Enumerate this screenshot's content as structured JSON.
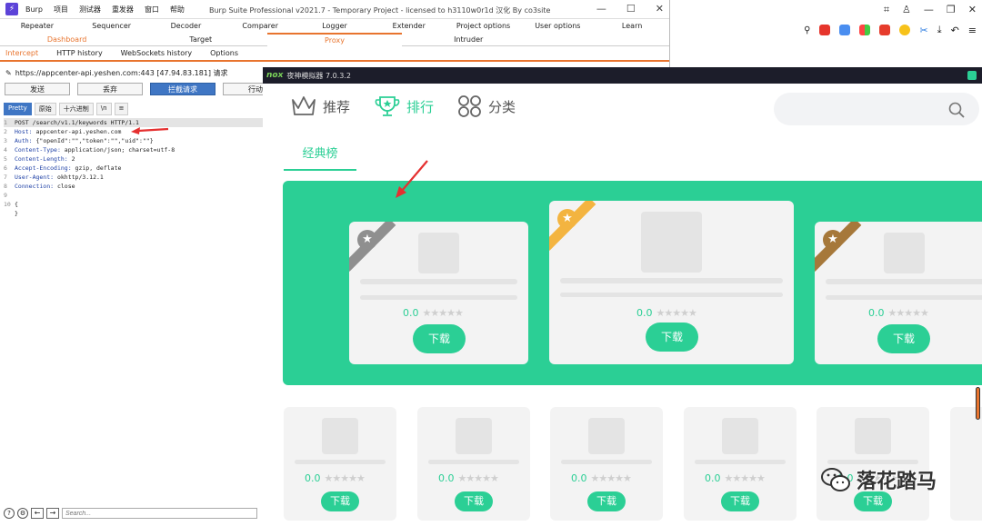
{
  "burp": {
    "window_title": "Burp Suite Professional v2021.7 - Temporary Project - licensed to h3110w0r1d 汉化 By co3site",
    "menu": [
      "Burp",
      "项目",
      "测试器",
      "重发器",
      "窗口",
      "帮助"
    ],
    "tabs_row1": [
      "Repeater",
      "Sequencer",
      "Decoder",
      "Comparer",
      "Logger",
      "Extender",
      "Project options",
      "User options",
      "Learn"
    ],
    "tabs_row2": [
      "Dashboard",
      "Target",
      "Proxy",
      "Intruder",
      ""
    ],
    "proxy_tabs": [
      "Intercept",
      "HTTP history",
      "WebSockets history",
      "Options"
    ],
    "request_info": "https://appcenter-api.yeshen.com:443  [47.94.83.181] 请求",
    "buttons": {
      "forward": "发送",
      "drop": "丢弃",
      "intercept": "拦截请求",
      "action": "行动"
    },
    "editor_tabs": [
      "Pretty",
      "原始",
      "十六进制",
      "\\n",
      "≡"
    ],
    "request_lines": [
      {
        "n": "1",
        "text": "POST /search/v1.1/keywords HTTP/1.1"
      },
      {
        "n": "2",
        "key": "Host:",
        "text": " appcenter-api.yeshen.com"
      },
      {
        "n": "3",
        "key": "Auth:",
        "text": " {\"openId\":\"\",\"token\":\"\",\"uid\":\"\"}"
      },
      {
        "n": "4",
        "key": "Content-Type:",
        "text": " application/json; charset=utf-8"
      },
      {
        "n": "5",
        "key": "Content-Length:",
        "text": " 2"
      },
      {
        "n": "6",
        "key": "Accept-Encoding:",
        "text": " gzip, deflate"
      },
      {
        "n": "7",
        "key": "User-Agent:",
        "text": " okhttp/3.12.1"
      },
      {
        "n": "8",
        "key": "Connection:",
        "text": " close"
      },
      {
        "n": "9",
        "text": ""
      },
      {
        "n": "10",
        "text": "{"
      },
      {
        "n": "",
        "text": "}"
      }
    ],
    "search_placeholder": "Search..."
  },
  "nox": {
    "logo": "nox",
    "title": "夜神模拟器 7.0.3.2",
    "nav": [
      "推荐",
      "排行",
      "分类"
    ],
    "active_nav": 1,
    "sub_tab": "经典榜",
    "rating": "0.0",
    "stars": "★★★★★",
    "download": "下载",
    "medal_colors": [
      "#8f8f8f",
      "#f3b440",
      "#a6783a"
    ]
  },
  "watermark": "落花踏马",
  "colors": {
    "accent": "#e8742e",
    "nox_green": "#2bcf95",
    "burp_blue": "#3f76c4"
  }
}
